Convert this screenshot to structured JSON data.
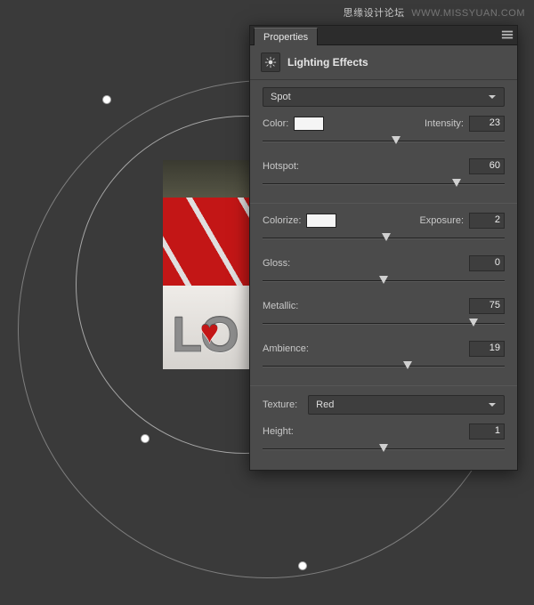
{
  "watermark": {
    "cn": "思缘设计论坛",
    "url": "WWW.MISSYUAN.COM"
  },
  "panel": {
    "tab_label": "Properties",
    "title": "Lighting Effects",
    "light_type": "Spot",
    "color_label": "Color:",
    "color_swatch": "#f5f5f5",
    "intensity_label": "Intensity:",
    "intensity_value": "23",
    "intensity_pct": 55,
    "hotspot_label": "Hotspot:",
    "hotspot_value": "60",
    "hotspot_pct": 80,
    "colorize_label": "Colorize:",
    "colorize_swatch": "#f5f5f5",
    "exposure_label": "Exposure:",
    "exposure_value": "2",
    "exposure_pct": 51,
    "gloss_label": "Gloss:",
    "gloss_value": "0",
    "gloss_pct": 50,
    "metallic_label": "Metallic:",
    "metallic_value": "75",
    "metallic_pct": 87,
    "ambience_label": "Ambience:",
    "ambience_value": "19",
    "ambience_pct": 60,
    "texture_label": "Texture:",
    "texture_value": "Red",
    "height_label": "Height:",
    "height_value": "1",
    "height_pct": 50
  },
  "image_letters": "LO"
}
